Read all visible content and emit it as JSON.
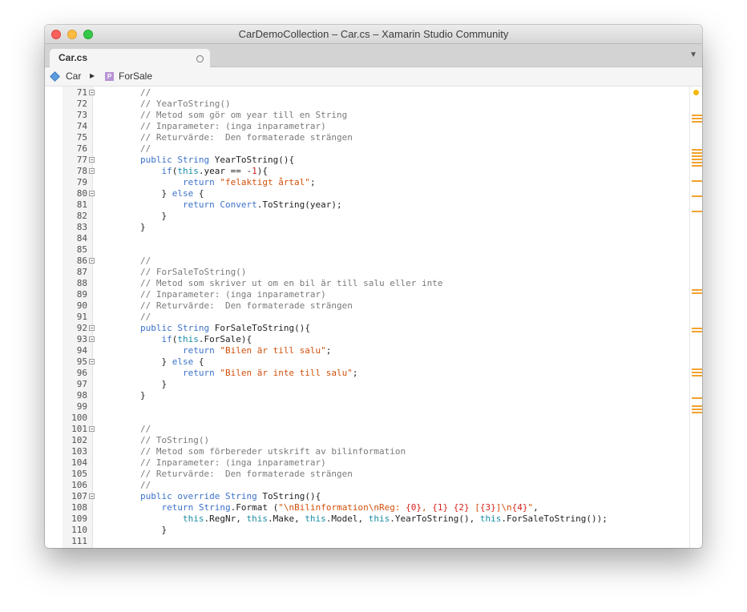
{
  "window": {
    "title": "CarDemoCollection – Car.cs – Xamarin Studio Community"
  },
  "tab": {
    "label": "Car.cs"
  },
  "pathbar": {
    "class_label": "Car",
    "member_label": "ForSale",
    "member_badge": "P"
  },
  "editor": {
    "lines": [
      {
        "n": "71",
        "fold": true,
        "tokens": [
          {
            "t": "        //",
            "c": "c"
          }
        ]
      },
      {
        "n": "72",
        "fold": false,
        "tokens": [
          {
            "t": "        // YearToString()",
            "c": "c"
          }
        ]
      },
      {
        "n": "73",
        "fold": false,
        "tokens": [
          {
            "t": "        // Metod som gör om year till en String",
            "c": "c"
          }
        ]
      },
      {
        "n": "74",
        "fold": false,
        "tokens": [
          {
            "t": "        // Inparameter: (inga inparametrar)",
            "c": "c"
          }
        ]
      },
      {
        "n": "75",
        "fold": false,
        "tokens": [
          {
            "t": "        // Returvärde:  Den formaterade strängen",
            "c": "c"
          }
        ]
      },
      {
        "n": "76",
        "fold": false,
        "tokens": [
          {
            "t": "        //",
            "c": "c"
          }
        ]
      },
      {
        "n": "77",
        "fold": true,
        "tokens": [
          {
            "t": "        "
          },
          {
            "t": "public",
            "c": "k"
          },
          {
            "t": " "
          },
          {
            "t": "String",
            "c": "k"
          },
          {
            "t": " YearToString(){"
          }
        ]
      },
      {
        "n": "78",
        "fold": true,
        "tokens": [
          {
            "t": "            "
          },
          {
            "t": "if",
            "c": "k"
          },
          {
            "t": "("
          },
          {
            "t": "this",
            "c": "th"
          },
          {
            "t": ".year == -"
          },
          {
            "t": "1",
            "c": "n"
          },
          {
            "t": "){"
          }
        ]
      },
      {
        "n": "79",
        "fold": false,
        "tokens": [
          {
            "t": "                "
          },
          {
            "t": "return",
            "c": "k"
          },
          {
            "t": " "
          },
          {
            "t": "\"felaktigt årtal\"",
            "c": "s"
          },
          {
            "t": ";"
          }
        ]
      },
      {
        "n": "80",
        "fold": true,
        "tokens": [
          {
            "t": "            } "
          },
          {
            "t": "else",
            "c": "k"
          },
          {
            "t": " {"
          }
        ]
      },
      {
        "n": "81",
        "fold": false,
        "tokens": [
          {
            "t": "                "
          },
          {
            "t": "return",
            "c": "k"
          },
          {
            "t": " "
          },
          {
            "t": "Convert",
            "c": "k"
          },
          {
            "t": ".ToString(year);"
          }
        ]
      },
      {
        "n": "82",
        "fold": false,
        "tokens": [
          {
            "t": "            }"
          }
        ]
      },
      {
        "n": "83",
        "fold": false,
        "tokens": [
          {
            "t": "        }"
          }
        ]
      },
      {
        "n": "84",
        "fold": false,
        "tokens": []
      },
      {
        "n": "85",
        "fold": false,
        "tokens": []
      },
      {
        "n": "86",
        "fold": true,
        "tokens": [
          {
            "t": "        //",
            "c": "c"
          }
        ]
      },
      {
        "n": "87",
        "fold": false,
        "tokens": [
          {
            "t": "        // ForSaleToString()",
            "c": "c"
          }
        ]
      },
      {
        "n": "88",
        "fold": false,
        "tokens": [
          {
            "t": "        // Metod som skriver ut om en bil är till salu eller inte",
            "c": "c"
          }
        ]
      },
      {
        "n": "89",
        "fold": false,
        "tokens": [
          {
            "t": "        // Inparameter: (inga inparametrar)",
            "c": "c"
          }
        ]
      },
      {
        "n": "90",
        "fold": false,
        "tokens": [
          {
            "t": "        // Returvärde:  Den formaterade strängen",
            "c": "c"
          }
        ]
      },
      {
        "n": "91",
        "fold": false,
        "tokens": [
          {
            "t": "        //",
            "c": "c"
          }
        ]
      },
      {
        "n": "92",
        "fold": true,
        "tokens": [
          {
            "t": "        "
          },
          {
            "t": "public",
            "c": "k"
          },
          {
            "t": " "
          },
          {
            "t": "String",
            "c": "k"
          },
          {
            "t": " ForSaleToString(){"
          }
        ]
      },
      {
        "n": "93",
        "fold": true,
        "tokens": [
          {
            "t": "            "
          },
          {
            "t": "if",
            "c": "k"
          },
          {
            "t": "("
          },
          {
            "t": "this",
            "c": "th"
          },
          {
            "t": ".ForSale){"
          }
        ]
      },
      {
        "n": "94",
        "fold": false,
        "tokens": [
          {
            "t": "                "
          },
          {
            "t": "return",
            "c": "k"
          },
          {
            "t": " "
          },
          {
            "t": "\"Bilen är till salu\"",
            "c": "s"
          },
          {
            "t": ";"
          }
        ]
      },
      {
        "n": "95",
        "fold": true,
        "tokens": [
          {
            "t": "            } "
          },
          {
            "t": "else",
            "c": "k"
          },
          {
            "t": " {"
          }
        ]
      },
      {
        "n": "96",
        "fold": false,
        "tokens": [
          {
            "t": "                "
          },
          {
            "t": "return",
            "c": "k"
          },
          {
            "t": " "
          },
          {
            "t": "\"Bilen är inte till salu\"",
            "c": "s"
          },
          {
            "t": ";"
          }
        ]
      },
      {
        "n": "97",
        "fold": false,
        "tokens": [
          {
            "t": "            }"
          }
        ]
      },
      {
        "n": "98",
        "fold": false,
        "tokens": [
          {
            "t": "        }"
          }
        ]
      },
      {
        "n": "99",
        "fold": false,
        "tokens": []
      },
      {
        "n": "100",
        "fold": false,
        "tokens": []
      },
      {
        "n": "101",
        "fold": true,
        "tokens": [
          {
            "t": "        //",
            "c": "c"
          }
        ]
      },
      {
        "n": "102",
        "fold": false,
        "tokens": [
          {
            "t": "        // ToString()",
            "c": "c"
          }
        ]
      },
      {
        "n": "103",
        "fold": false,
        "tokens": [
          {
            "t": "        // Metod som förbereder utskrift av bilinformation",
            "c": "c"
          }
        ]
      },
      {
        "n": "104",
        "fold": false,
        "tokens": [
          {
            "t": "        // Inparameter: (inga inparametrar)",
            "c": "c"
          }
        ]
      },
      {
        "n": "105",
        "fold": false,
        "tokens": [
          {
            "t": "        // Returvärde:  Den formaterade strängen",
            "c": "c"
          }
        ]
      },
      {
        "n": "106",
        "fold": false,
        "tokens": [
          {
            "t": "        //",
            "c": "c"
          }
        ]
      },
      {
        "n": "107",
        "fold": true,
        "tokens": [
          {
            "t": "        "
          },
          {
            "t": "public",
            "c": "k"
          },
          {
            "t": " "
          },
          {
            "t": "override",
            "c": "k"
          },
          {
            "t": " "
          },
          {
            "t": "String",
            "c": "k"
          },
          {
            "t": " ToString(){"
          }
        ]
      },
      {
        "n": "108",
        "fold": false,
        "tokens": [
          {
            "t": "            "
          },
          {
            "t": "return",
            "c": "k"
          },
          {
            "t": " "
          },
          {
            "t": "String",
            "c": "k"
          },
          {
            "t": ".Format ("
          },
          {
            "t": "\"\\nBilinformation\\nReg: ",
            "c": "s"
          },
          {
            "t": "{0}",
            "c": "f"
          },
          {
            "t": ", ",
            "c": "s"
          },
          {
            "t": "{1}",
            "c": "f"
          },
          {
            "t": " ",
            "c": "s"
          },
          {
            "t": "{2}",
            "c": "f"
          },
          {
            "t": " [",
            "c": "s"
          },
          {
            "t": "{3}",
            "c": "f"
          },
          {
            "t": "]\\n",
            "c": "s"
          },
          {
            "t": "{4}",
            "c": "f"
          },
          {
            "t": "\"",
            "c": "s"
          },
          {
            "t": ","
          }
        ]
      },
      {
        "n": "109",
        "fold": false,
        "tokens": [
          {
            "t": "                "
          },
          {
            "t": "this",
            "c": "th"
          },
          {
            "t": ".RegNr, "
          },
          {
            "t": "this",
            "c": "th"
          },
          {
            "t": ".Make, "
          },
          {
            "t": "this",
            "c": "th"
          },
          {
            "t": ".Model, "
          },
          {
            "t": "this",
            "c": "th"
          },
          {
            "t": ".YearToString(), "
          },
          {
            "t": "this",
            "c": "th"
          },
          {
            "t": ".ForSaleToString());"
          }
        ]
      },
      {
        "n": "110",
        "fold": false,
        "tokens": [
          {
            "t": "            }"
          }
        ]
      },
      {
        "n": "111",
        "fold": false,
        "tokens": []
      }
    ]
  },
  "colors": {
    "comment": "#7a7a7a",
    "keyword": "#3b71c8",
    "string": "#d1500b",
    "format": "#d6221c",
    "marker": "#f3a22e"
  }
}
